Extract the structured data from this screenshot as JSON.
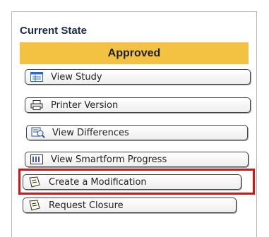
{
  "panel": {
    "title": "Current State",
    "state": "Approved"
  },
  "actions": [
    {
      "label": "View Study",
      "icon": "study-window-icon"
    },
    {
      "label": "Printer Version",
      "icon": "printer-icon"
    },
    {
      "label": "View Differences",
      "icon": "differences-icon"
    },
    {
      "label": "View Smartform Progress",
      "icon": "smartform-progress-icon"
    },
    {
      "label": "Create  a Modification",
      "icon": "document-icon"
    },
    {
      "label": "Request Closure",
      "icon": "document-icon"
    }
  ],
  "colors": {
    "state_badge": "#f4c243",
    "highlight": "#e01010"
  }
}
